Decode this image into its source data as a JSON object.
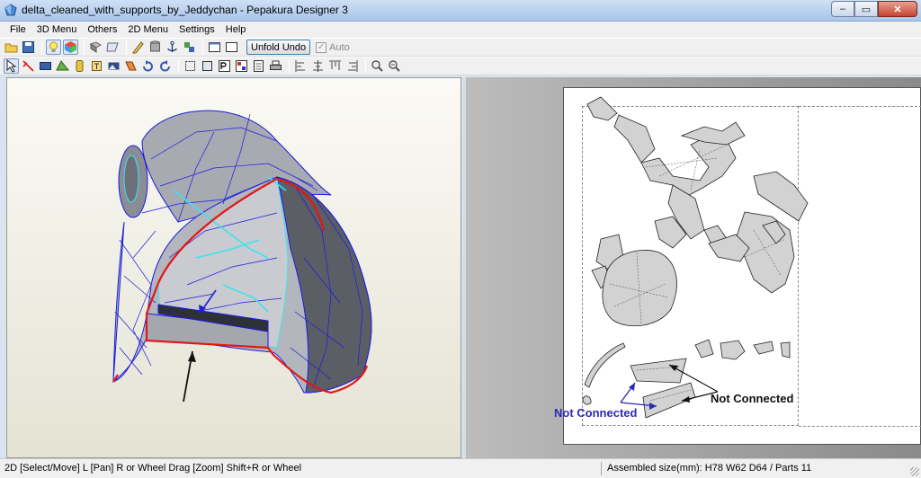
{
  "window": {
    "title": "delta_cleaned_with_supports_by_Jeddychan - Pepakura Designer 3",
    "minimize_glyph": "–",
    "maximize_glyph": "▭",
    "close_glyph": "✕"
  },
  "menu": [
    "File",
    "3D Menu",
    "Others",
    "2D Menu",
    "Settings",
    "Help"
  ],
  "toolbar1": {
    "unfold_undo_label": "Unfold Undo",
    "auto_label": "Auto",
    "auto_checked": true
  },
  "icons": {
    "toolbar1": [
      "open-icon",
      "save-icon",
      "lightbulb-icon",
      "texture-icon",
      "rotate-icon",
      "paper-icon",
      "pencil-icon",
      "cylinder-icon",
      "anchor-icon",
      "join-icon",
      "page-icon",
      "page-alt-icon"
    ],
    "toolbar2": [
      "select-icon",
      "edge-icon",
      "film-icon",
      "flap-icon",
      "color-icon",
      "text-icon",
      "image-icon",
      "fold-icon",
      "rotate-part-icon",
      "rotate-ccw-icon",
      "frame-icon",
      "frame-alt-icon",
      "page-number-icon",
      "layout-icon",
      "settings-icon",
      "print-icon",
      "align-left-icon",
      "align-center-icon",
      "align-top-icon",
      "align-right-icon",
      "zoom-in-icon",
      "zoom-out-icon"
    ]
  },
  "annotations": {
    "not_connected_black": "Not Connected",
    "not_connected_blue": "Not Connected"
  },
  "status": {
    "left": "2D [Select/Move] L [Pan] R or Wheel Drag [Zoom] Shift+R or Wheel",
    "right": "Assembled size(mm): H78 W62 D64 / Parts 11"
  },
  "colors": {
    "edge_blue": "#1a1ae0",
    "edge_red": "#e01818",
    "edge_cyan": "#3ae4f0",
    "label_blue": "#2a2ab8"
  }
}
